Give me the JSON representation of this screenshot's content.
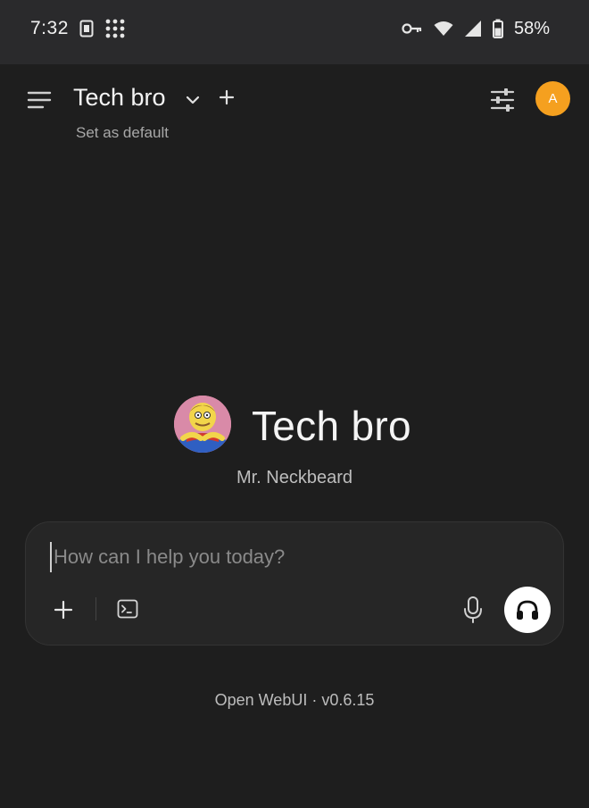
{
  "status_bar": {
    "time": "7:32",
    "battery_percent": "58%",
    "icons": [
      "sim-card-icon",
      "app-grid-icon",
      "vpn-key-icon",
      "wifi-icon",
      "signal-icon",
      "battery-icon"
    ]
  },
  "header": {
    "model_name": "Tech bro",
    "set_default_label": "Set as default",
    "user_avatar_initial": "A",
    "accent_color": "#f5a01f"
  },
  "hero": {
    "model_name": "Tech bro",
    "model_description": "Mr. Neckbeard"
  },
  "composer": {
    "placeholder": "How can I help you today?",
    "value": ""
  },
  "footer": {
    "version_text": "Open WebUI · v0.6.15"
  }
}
